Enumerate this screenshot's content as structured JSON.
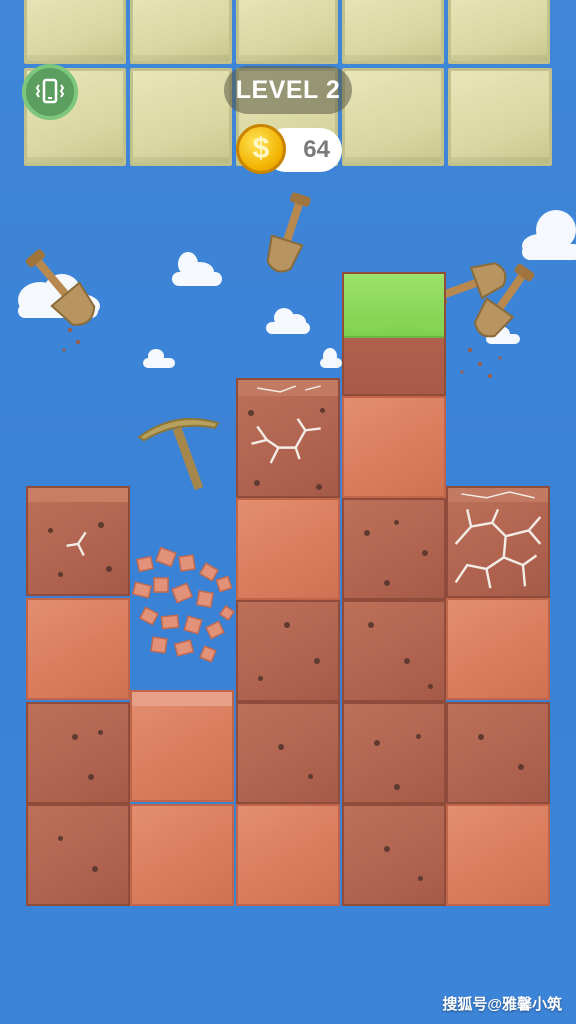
{
  "hud": {
    "level_label": "LEVEL 2",
    "coins": "64",
    "coin_symbol": "$",
    "vibrate_icon": "phone-vibrate-icon"
  },
  "colors": {
    "sky": "#3f86d8",
    "stone": "#dedbaa",
    "plain_block": "#dd8566",
    "dirt_block": "#b26552",
    "grass": "#8cd85c",
    "coin": "#f2b400"
  },
  "tools": [
    "shovel",
    "shovel",
    "shovel",
    "shovel",
    "pickaxe"
  ],
  "watermark": "搜狐号@雅馨小筑"
}
